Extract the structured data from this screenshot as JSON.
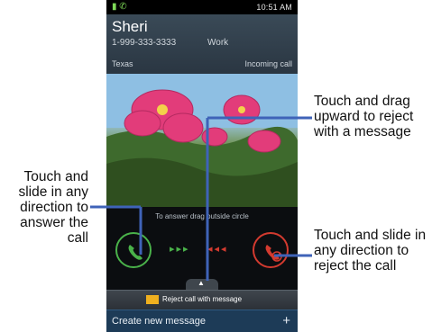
{
  "status_bar": {
    "time": "10:51 AM"
  },
  "caller": {
    "name": "Sheri",
    "number": "1-999-333-3333",
    "number_type": "Work",
    "location": "Texas",
    "call_status": "Incoming call"
  },
  "call_panel": {
    "hint": "To answer drag outside circle",
    "arrows_green": "▸▸▸",
    "arrows_red": "◂◂◂"
  },
  "reject_bar": {
    "label": "Reject call with message"
  },
  "create_message": {
    "label": "Create new message",
    "plus": "+"
  },
  "callouts": {
    "answer": "Touch and slide in any direction to answer the call",
    "reject_message": "Touch and drag upward to reject with a message",
    "reject_call": "Touch and slide in any direction to reject the call"
  },
  "colors": {
    "line": "#3f63b8",
    "answer": "#4ab24a",
    "reject": "#d33a2f"
  },
  "icons": [
    "signal-icon",
    "battery-icon",
    "phone-icon",
    "envelope-icon",
    "plus-icon"
  ]
}
